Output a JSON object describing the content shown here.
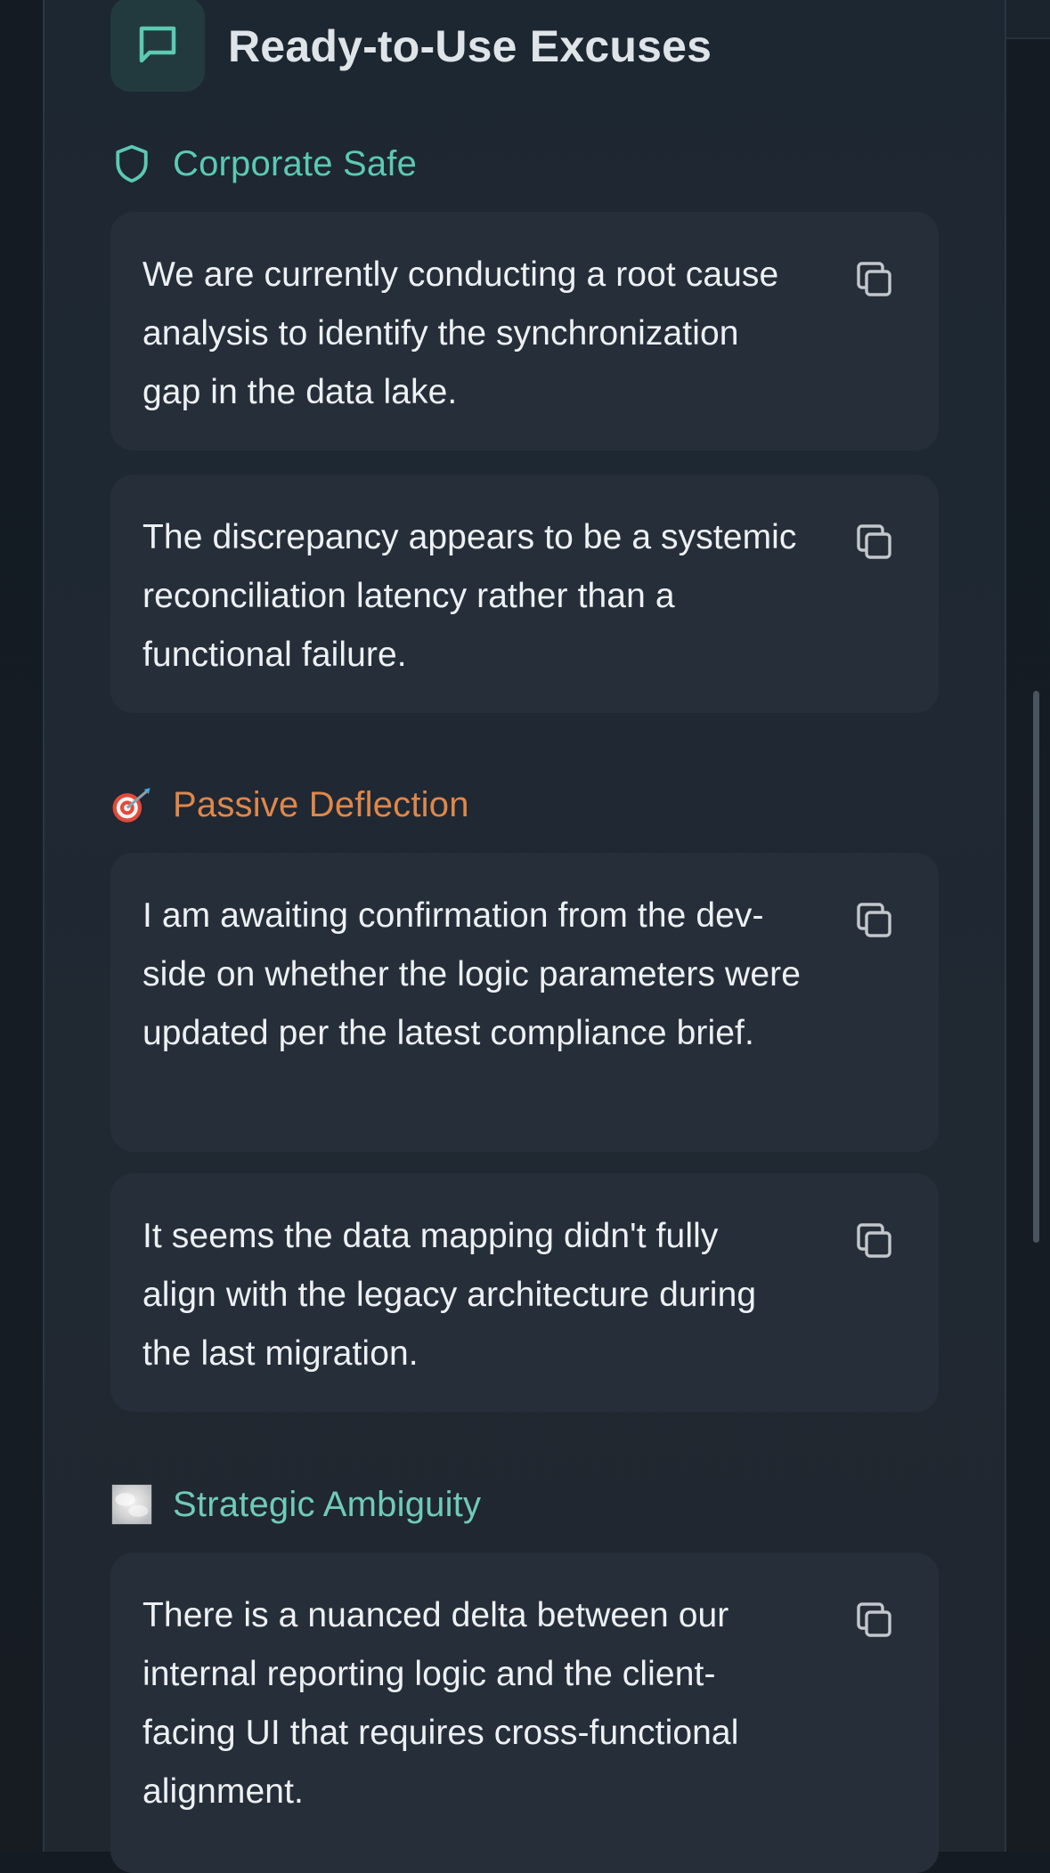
{
  "header": {
    "title": "Ready-to-Use Excuses",
    "icon": "message-square-icon"
  },
  "colors": {
    "teal": "#5cc9b3",
    "orange": "#e0874a",
    "text": "#eef1f4"
  },
  "sections": [
    {
      "label": "Corporate Safe",
      "icon": "shield-icon",
      "color": "#5cc9b3",
      "items": [
        {
          "text": "We are currently conducting a root cause analysis to identify the synchronization gap in the data lake."
        },
        {
          "text": "The discrepancy appears to be a systemic reconciliation latency rather than a functional failure."
        }
      ]
    },
    {
      "label": "Passive Deflection",
      "icon": "dart-target-emoji",
      "color": "#e0874a",
      "items": [
        {
          "text": "I am awaiting confirmation from the dev-side on whether the logic parameters were updated per the latest compliance brief."
        },
        {
          "text": "It seems the data mapping didn't fully align with the legacy architecture during the last migration."
        }
      ]
    },
    {
      "label": "Strategic Ambiguity",
      "icon": "fog-emoji",
      "color": "#6fcbb8",
      "items": [
        {
          "text": "There is a nuanced delta between our internal reporting logic and the client-facing UI that requires cross-functional alignment."
        }
      ]
    }
  ]
}
